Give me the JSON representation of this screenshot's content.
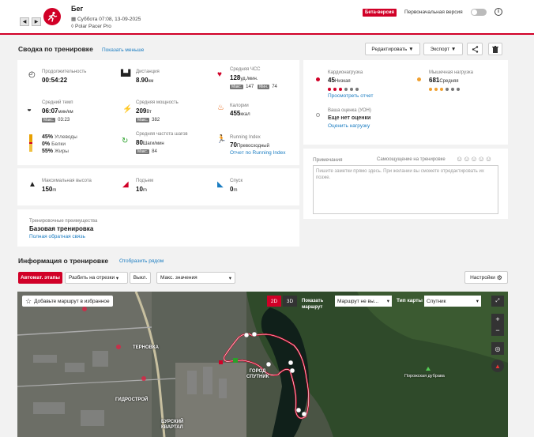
{
  "header": {
    "sport": "Бег",
    "datetime": "Суббота 07:08, 13-09-2025",
    "device": "Polar Pacer Pro",
    "beta": "Бета-версия",
    "original_label": "Первоначальная версия",
    "prev": "◀",
    "next": "▶"
  },
  "summary": {
    "title": "Сводка по тренировке",
    "show_less": "Показать меньше",
    "edit": "Редактировать",
    "export": "Экспорт"
  },
  "stats": {
    "duration": {
      "label": "Продолжительность",
      "value": "00:54:22"
    },
    "distance": {
      "label": "Дистанция",
      "value": "8.90",
      "unit": "км"
    },
    "hr_avg": {
      "label": "Средняя ЧСС",
      "value": "128",
      "unit": "уд./мин.",
      "max_tag": "Макс.",
      "max": "147",
      "min_tag": "Мин.",
      "min": "74"
    },
    "pace": {
      "label": "Средний темп",
      "value": "06:07",
      "unit": "мин/км",
      "max_tag": "Макс.",
      "max": "03:23"
    },
    "power": {
      "label": "Средняя мощность",
      "value": "209",
      "unit": "Вт",
      "max_tag": "Макс.",
      "max": "382"
    },
    "calories": {
      "label": "Калории",
      "value": "455",
      "unit": "ккал"
    },
    "fuel": {
      "carbs": "45%",
      "carbs_label": "Углеводы",
      "protein": "0%",
      "protein_label": "Белки",
      "fat": "55%",
      "fat_label": "Жиры"
    },
    "cadence": {
      "label": "Средняя частота шагов",
      "value": "80",
      "unit": "Шаги/мин",
      "max_tag": "Макс.",
      "max": "84"
    },
    "running_index": {
      "label": "Running Index",
      "value": "70",
      "unit": "Превосходный",
      "link": "Отчет по Running Index"
    },
    "max_alt": {
      "label": "Максимальная высота",
      "value": "150",
      "unit": "m"
    },
    "ascent": {
      "label": "Подъем",
      "value": "10",
      "unit": "m"
    },
    "descent": {
      "label": "Спуск",
      "value": "0",
      "unit": "m"
    }
  },
  "load": {
    "cardio_label": "Кардионагрузка",
    "cardio_value": "45",
    "cardio_level": "Низкая",
    "cardio_link": "Просмотреть отчет",
    "muscle_label": "Мышечная нагрузка",
    "muscle_value": "681",
    "muscle_level": "Средняя",
    "rating_label": "Ваша оценка (УОН)",
    "rating_value": "Еще нет оценки",
    "rating_link": "Оценить нагрузку"
  },
  "notes": {
    "label": "Примечания",
    "feeling_label": "Самоощущение на тренировке",
    "placeholder": "Пишите заметки прямо здесь. При желании вы сможете отредактировать их позже."
  },
  "benefit": {
    "label": "Тренировочные преимущества",
    "value": "Базовая тренировка",
    "link": "Полная обратная связь"
  },
  "info": {
    "title": "Информация о тренировке",
    "side_by_side": "Отобразить рядом",
    "auto_laps": "Автомат. этапы",
    "split": "Разбить на отрезки",
    "off": "Выкл.",
    "max_values": "Макс. значения",
    "settings": "Настройки"
  },
  "map": {
    "fav": "Добавьте маршрут в избранное",
    "mode2d": "2D",
    "mode3d": "3D",
    "show_route": "Показать маршрут",
    "route_select": "Маршрут не вы...",
    "map_type_label": "Тип карты",
    "map_type": "Спутник",
    "zoom_in": "+",
    "zoom_out": "−",
    "labels": [
      "ТЕРНОВКА",
      "ГИДРОСТРОЙ",
      "ГОРОД СПУТНИК",
      "Порожская дубрава",
      "БУРСКИЙ КВАРТАЛ"
    ]
  },
  "colors": {
    "accent": "#d10027",
    "link": "#1a7cc1",
    "cardio": "#d10027",
    "muscle": "#f0a030"
  }
}
